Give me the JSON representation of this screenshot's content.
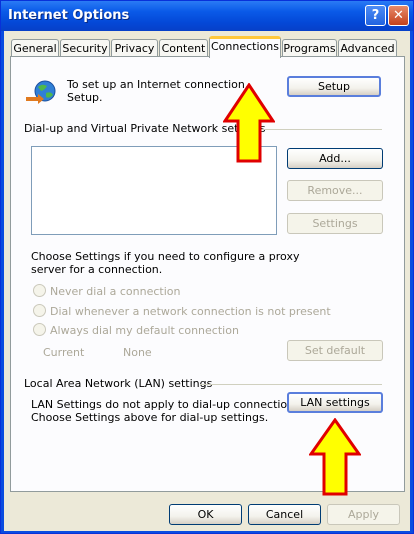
{
  "window": {
    "title": "Internet Options",
    "help_glyph": "?",
    "close_glyph": "✕"
  },
  "tabs": [
    {
      "label": "General"
    },
    {
      "label": "Security"
    },
    {
      "label": "Privacy"
    },
    {
      "label": "Content"
    },
    {
      "label": "Connections",
      "active": true
    },
    {
      "label": "Programs"
    },
    {
      "label": "Advanced"
    }
  ],
  "setup": {
    "text_line1": "To set up an Internet connection,",
    "text_line2": "Setup.",
    "button": "Setup"
  },
  "dialup": {
    "heading": "Dial-up and Virtual Private Network settings",
    "add": "Add...",
    "remove": "Remove...",
    "settings": "Settings",
    "proxy_line1": "Choose Settings if you need to configure a proxy",
    "proxy_line2": "server for a connection.",
    "radios": [
      {
        "label": "Never dial a connection",
        "checked": true
      },
      {
        "label": "Dial whenever a network connection is not present",
        "checked": false
      },
      {
        "label": "Always dial my default connection",
        "checked": false
      }
    ],
    "current_label": "Current",
    "current_value": "None",
    "set_default": "Set default"
  },
  "lan": {
    "heading": "Local Area Network (LAN) settings",
    "line1": "LAN Settings do not apply to dial-up connections.",
    "line2": "Choose Settings above for dial-up settings.",
    "button": "LAN settings"
  },
  "footer": {
    "ok": "OK",
    "cancel": "Cancel",
    "apply": "Apply"
  },
  "colors": {
    "arrow_fill": "#ffff00",
    "arrow_stroke": "#e00000",
    "title_bar": "#0a5ae8"
  },
  "icons": [
    "globe-connection-icon",
    "help-icon",
    "close-icon",
    "up-arrow-annotation"
  ]
}
